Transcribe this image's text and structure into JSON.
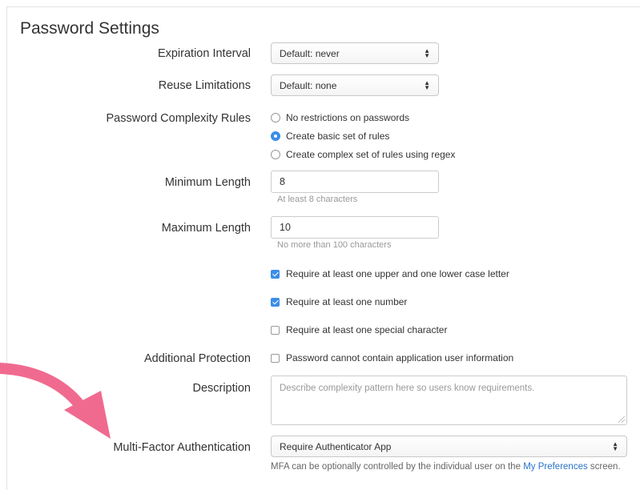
{
  "panel": {
    "title": "Password Settings"
  },
  "expiration": {
    "label": "Expiration Interval",
    "value": "Default: never"
  },
  "reuse": {
    "label": "Reuse Limitations",
    "value": "Default: none"
  },
  "complexity": {
    "label": "Password Complexity Rules",
    "options": [
      {
        "label": "No restrictions on passwords",
        "selected": false
      },
      {
        "label": "Create basic set of rules",
        "selected": true
      },
      {
        "label": "Create complex set of rules using regex",
        "selected": false
      }
    ]
  },
  "min_length": {
    "label": "Minimum Length",
    "value": "8",
    "help": "At least 8 characters"
  },
  "max_length": {
    "label": "Maximum Length",
    "value": "10",
    "help": "No more than 100 characters"
  },
  "rules": [
    {
      "label": "Require at least one upper and one lower case letter",
      "checked": true
    },
    {
      "label": "Require at least one number",
      "checked": true
    },
    {
      "label": "Require at least one special character",
      "checked": false
    }
  ],
  "additional": {
    "label": "Additional Protection",
    "option": "Password cannot contain application user information",
    "checked": false
  },
  "description": {
    "label": "Description",
    "placeholder": "Describe complexity pattern here so users know requirements."
  },
  "mfa": {
    "label": "Multi-Factor Authentication",
    "value": "Require Authenticator App",
    "note_prefix": "MFA can be optionally controlled by the individual user on the",
    "note_link": "My Preferences",
    "note_suffix": "screen."
  },
  "colors": {
    "accent": "#3a8ee6",
    "arrow": "#f06a8f",
    "link": "#2a72c8"
  }
}
